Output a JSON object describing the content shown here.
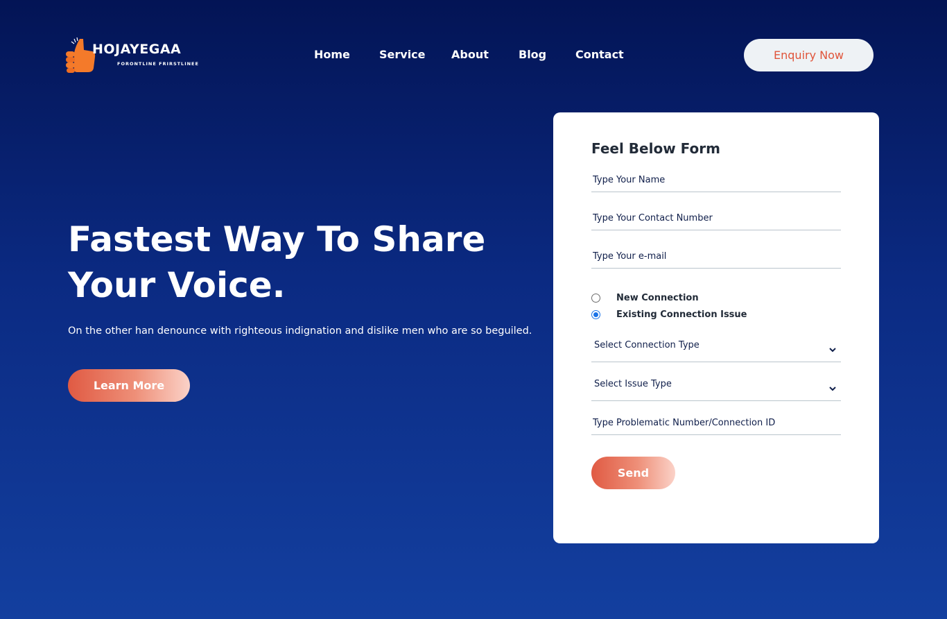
{
  "brand": {
    "name": "HOJAYEGAA",
    "tagline": "FORONTLINE FRIRSTLINEE"
  },
  "nav": {
    "items": [
      "Home",
      "Service",
      "About",
      "Blog",
      "Contact"
    ]
  },
  "header": {
    "enquiry_label": "Enquiry Now"
  },
  "hero": {
    "title": "Fastest Way To Share Your Voice.",
    "subtitle": "On the other han denounce with righteous indignation and dislike men who are so beguiled.",
    "cta_label": "Learn More"
  },
  "form": {
    "title": "Feel Below Form",
    "name_placeholder": "Type Your Name",
    "contact_placeholder": "Type Your Contact Number",
    "email_placeholder": "Type Your e-mail",
    "radios": [
      {
        "label": "New Connection",
        "checked": false
      },
      {
        "label": "Existing Connection Issue",
        "checked": true
      }
    ],
    "connection_type_label": "Select Connection Type",
    "issue_type_label": "Select Issue Type",
    "problem_placeholder": "Type Problematic Number/Connection ID",
    "send_label": "Send"
  },
  "colors": {
    "accent": "#e05a43",
    "background_top": "#031455",
    "background_bottom": "#133f9f",
    "radio_selected": "#1a73e8"
  }
}
